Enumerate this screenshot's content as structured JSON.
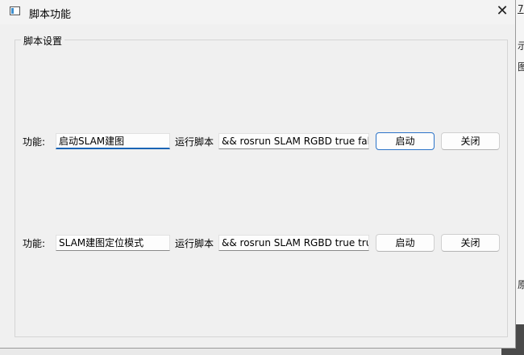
{
  "window": {
    "title": "脚本功能"
  },
  "group": {
    "title": "脚本设置"
  },
  "rows": [
    {
      "func_label": "功能:",
      "func_value": "启动SLAM建图",
      "script_label": "运行脚本",
      "script_value": "&& rosrun SLAM RGBD true false",
      "start_label": "启动",
      "close_label": "关闭"
    },
    {
      "func_label": "功能:",
      "func_value": "SLAM建图定位模式",
      "script_label": "运行脚本",
      "script_value": "&& rosrun SLAM RGBD true true",
      "start_label": "启动",
      "close_label": "关闭"
    }
  ],
  "background": {
    "frag1": "7",
    "frag2": "示",
    "frag3": "图",
    "frag4": "原"
  },
  "icons": {
    "app": "window-icon",
    "close": "close-icon"
  }
}
